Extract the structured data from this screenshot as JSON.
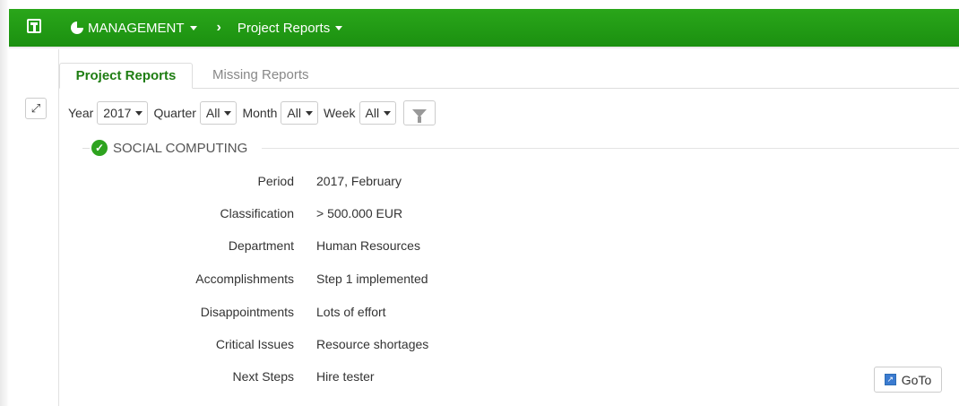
{
  "nav": {
    "management_label": "MANAGEMENT",
    "separator": "›",
    "project_reports_label": "Project Reports"
  },
  "tabs": [
    {
      "label": "Project Reports",
      "active": true
    },
    {
      "label": "Missing Reports",
      "active": false
    }
  ],
  "filters": {
    "year_label": "Year",
    "year_value": "2017",
    "quarter_label": "Quarter",
    "quarter_value": "All",
    "month_label": "Month",
    "month_value": "All",
    "week_label": "Week",
    "week_value": "All"
  },
  "section": {
    "title": "SOCIAL COMPUTING",
    "status_icon": "check-circle-icon"
  },
  "report": [
    {
      "label": "Period",
      "value": "2017, February"
    },
    {
      "label": "Classification",
      "value": "> 500.000 EUR"
    },
    {
      "label": "Department",
      "value": "Human Resources"
    },
    {
      "label": "Accomplishments",
      "value": "Step 1 implemented"
    },
    {
      "label": "Disappointments",
      "value": "Lots of effort"
    },
    {
      "label": "Critical Issues",
      "value": "Resource shortages"
    },
    {
      "label": "Next Steps",
      "value": "Hire tester"
    }
  ],
  "goto_label": "GoTo",
  "colors": {
    "topbar": "#1f9a14",
    "active_tab": "#1e7d12",
    "check": "#2ea31f"
  }
}
